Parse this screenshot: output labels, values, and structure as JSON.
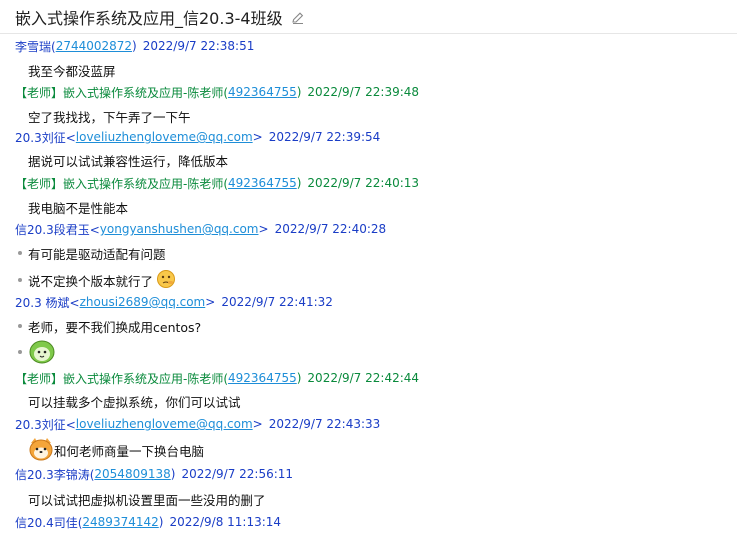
{
  "header": {
    "title": "嵌入式操作系统及应用_信20.3-4班级"
  },
  "messages": [
    {
      "sender": "李雪瑞(",
      "id": "2744002872",
      "sender_suffix": ")",
      "time": "2022/9/7 22:38:51",
      "text": "我至今都没蓝屏",
      "color": "blue"
    },
    {
      "sender": "【老师】嵌入式操作系统及应用-陈老师(",
      "id": "492364755",
      "sender_suffix": ")",
      "time": "2022/9/7 22:39:48",
      "text": "空了我找找，下午弄了一下午",
      "color": "green"
    },
    {
      "sender": "20.3刘征<",
      "id": "loveliuzhengloveme@qq.com",
      "sender_suffix": ">",
      "time": "2022/9/7 22:39:54",
      "text": "据说可以试试兼容性运行，降低版本",
      "color": "blue"
    },
    {
      "sender": "【老师】嵌入式操作系统及应用-陈老师(",
      "id": "492364755",
      "sender_suffix": ")",
      "time": "2022/9/7 22:40:13",
      "text": "我电脑不是性能本",
      "color": "green"
    },
    {
      "sender": "信20.3段君玉<",
      "id": "yongyanshushen@qq.com",
      "sender_suffix": ">",
      "time": "2022/9/7 22:40:28",
      "texts": [
        "有可能是驱动适配有问题",
        "说不定换个版本就行了"
      ],
      "color": "blue"
    },
    {
      "sender": "20.3 杨斌<",
      "id": "zhousi2689@qq.com",
      "sender_suffix": ">",
      "time": "2022/9/7 22:41:32",
      "texts": [
        "老师，要不我们换成用centos?",
        ""
      ],
      "color": "blue"
    },
    {
      "sender": "【老师】嵌入式操作系统及应用-陈老师(",
      "id": "492364755",
      "sender_suffix": ")",
      "time": "2022/9/7 22:42:44",
      "text": "可以挂载多个虚拟系统，你们可以试试",
      "color": "green"
    },
    {
      "sender": "20.3刘征<",
      "id": "loveliuzhengloveme@qq.com",
      "sender_suffix": ">",
      "time": "2022/9/7 22:43:33",
      "text": "和何老师商量一下换台电脑",
      "color": "blue"
    },
    {
      "sender": "信20.3李锦涛(",
      "id": "2054809138",
      "sender_suffix": ")",
      "time": "2022/9/7 22:56:11",
      "text": "可以试试把虚拟机设置里面一些没用的删了",
      "color": "blue"
    },
    {
      "sender": "信20.4司佳(",
      "id": "2489374142",
      "sender_suffix": ")",
      "time": "2022/9/8 11:13:14",
      "color": "blue"
    }
  ],
  "colors": {
    "sender_blue": "#1a3dc6",
    "teacher_green": "#0a8a3c",
    "link": "#1e8ed8"
  }
}
